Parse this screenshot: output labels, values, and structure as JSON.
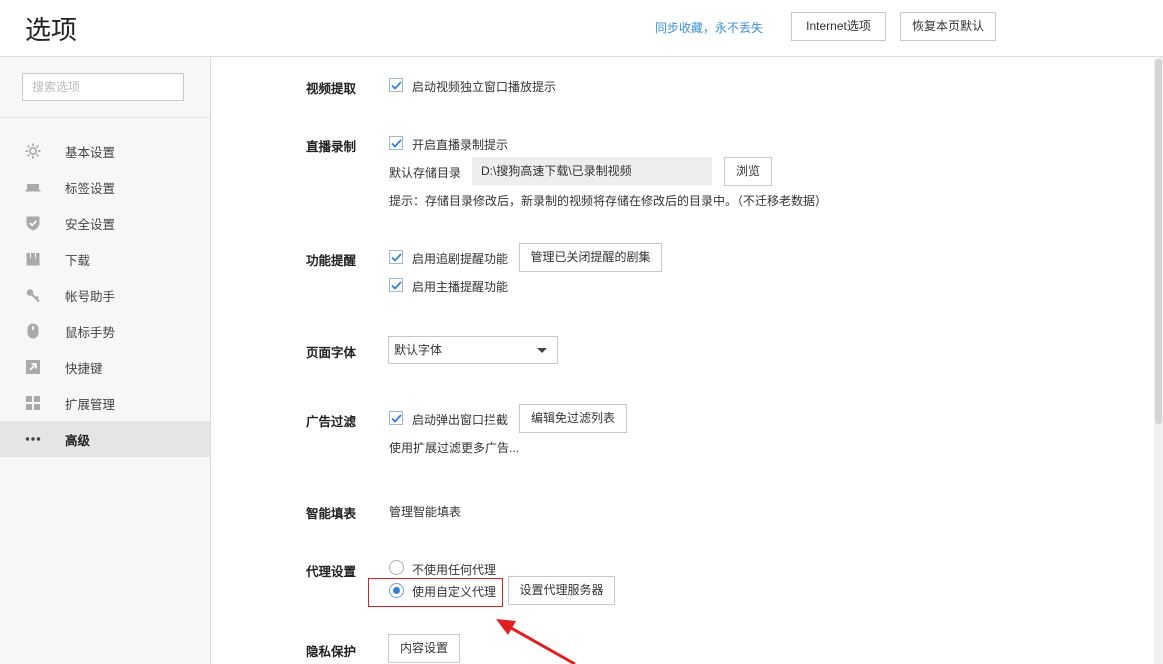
{
  "header": {
    "title": "选项",
    "sync_link": "同步收藏，永不丢失",
    "internet_button": "Internet选项",
    "restore_button": "恢复本页默认"
  },
  "sidebar": {
    "search_placeholder": "搜索选项",
    "items": [
      {
        "label": "基本设置",
        "icon": "gear-icon",
        "active": false
      },
      {
        "label": "标签设置",
        "icon": "tab-icon",
        "active": false
      },
      {
        "label": "安全设置",
        "icon": "shield-icon",
        "active": false
      },
      {
        "label": "下载",
        "icon": "download-icon",
        "active": false
      },
      {
        "label": "帐号助手",
        "icon": "key-icon",
        "active": false
      },
      {
        "label": "鼠标手势",
        "icon": "mouse-icon",
        "active": false
      },
      {
        "label": "快捷键",
        "icon": "shortcut-arrow-icon",
        "active": false
      },
      {
        "label": "扩展管理",
        "icon": "extensions-grid-icon",
        "active": false
      },
      {
        "label": "高级",
        "icon": "more-dots-icon",
        "active": true
      }
    ]
  },
  "sections": {
    "video": {
      "label": "视频提取",
      "checkbox": "启动视频独立窗口播放提示",
      "checked": true
    },
    "live": {
      "label": "直播录制",
      "checkbox": "开启直播录制提示",
      "checked": true,
      "dir_label": "默认存储目录",
      "dir_value": "D:\\搜狗高速下载\\已录制视频",
      "browse_button": "浏览",
      "hint": "提示：存储目录修改后，新录制的视频将存储在修改后的目录中。（不迁移老数据）"
    },
    "reminder": {
      "label": "功能提醒",
      "checkbox1": "启用追剧提醒功能",
      "checkbox1_checked": true,
      "manage_button": "管理已关闭提醒的剧集",
      "checkbox2": "启用主播提醒功能",
      "checkbox2_checked": true
    },
    "font": {
      "label": "页面字体",
      "selected": "默认字体"
    },
    "adfilter": {
      "label": "广告过滤",
      "checkbox": "启动弹出窗口拦截",
      "checked": true,
      "edit_button": "编辑免过滤列表",
      "link": "使用扩展过滤更多广告..."
    },
    "autofill": {
      "label": "智能填表",
      "link": "管理智能填表"
    },
    "proxy": {
      "label": "代理设置",
      "option_none": "不使用任何代理",
      "option_custom": "使用自定义代理",
      "selected": "custom",
      "server_button": "设置代理服务器"
    },
    "privacy": {
      "label": "隐私保护",
      "content_button": "内容设置"
    }
  },
  "colors": {
    "accent_blue": "#3d8fd6",
    "highlight_red": "#e02020",
    "check_blue": "#2f7fd1"
  }
}
